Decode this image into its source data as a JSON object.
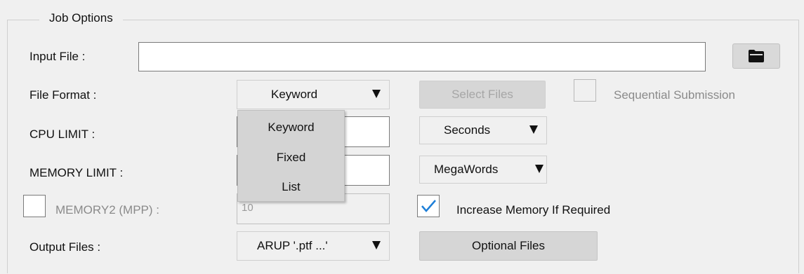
{
  "group_title": "Job Options",
  "input_file": {
    "label": "Input File :",
    "value": ""
  },
  "file_format": {
    "label": "File Format :",
    "selected": "Keyword",
    "options": [
      "Keyword",
      "Fixed",
      "List"
    ]
  },
  "select_files_button": "Select Files",
  "sequential_submission": {
    "label": "Sequential Submission",
    "checked": false
  },
  "cpu_limit": {
    "label": "CPU LIMIT :",
    "value": "",
    "unit": "Seconds"
  },
  "memory_limit": {
    "label": "MEMORY LIMIT :",
    "value": "",
    "unit": "MegaWords"
  },
  "memory2": {
    "label": "MEMORY2 (MPP) :",
    "value": "10",
    "checked": false
  },
  "increase_memory": {
    "label": "Increase Memory If Required",
    "checked": true
  },
  "output_files": {
    "label": "Output Files :",
    "selected": "ARUP '.ptf ...'"
  },
  "optional_files_button": "Optional Files",
  "icons": {
    "browse": "folder-icon",
    "check": "checkmark-icon",
    "dropdown": "triangle-down-icon"
  },
  "colors": {
    "check_accent": "#1e7fd8",
    "popup_bg": "#d4d4d4"
  }
}
